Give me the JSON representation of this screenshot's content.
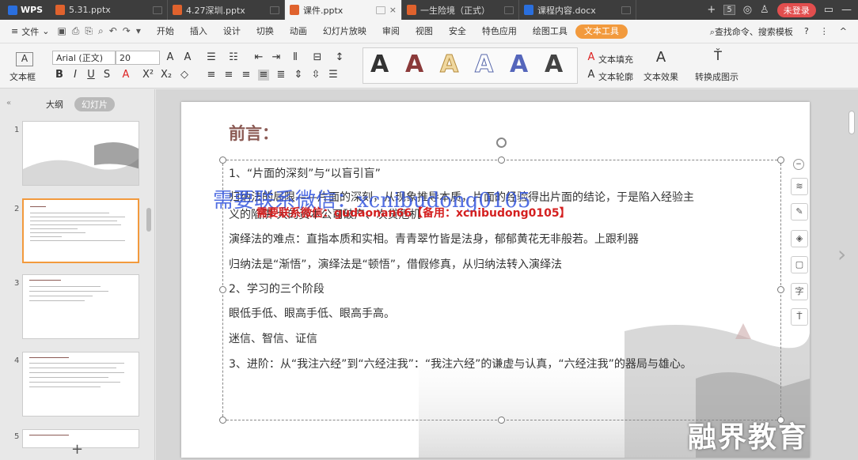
{
  "tabs": [
    {
      "label": "5.31.pptx",
      "type": "ppt"
    },
    {
      "label": "4.27深圳.pptx",
      "type": "ppt"
    },
    {
      "label": "课件.pptx",
      "type": "ppt",
      "active": true
    },
    {
      "label": "一生险境（正式）",
      "type": "ppt"
    },
    {
      "label": "课程内容.docx",
      "type": "doc"
    }
  ],
  "app": {
    "brand": "WPS",
    "add_tab": "+",
    "tab_count": "5",
    "login_label": "未登录"
  },
  "menubar": {
    "file_label": "文件",
    "items": [
      "开始",
      "插入",
      "设计",
      "切换",
      "动画",
      "幻灯片放映",
      "审阅",
      "视图",
      "安全",
      "特色应用",
      "绘图工具",
      "文本工具"
    ],
    "active_item": "文本工具",
    "search_label": "查找命令、搜索模板",
    "help": "?",
    "more": "⋮",
    "collapse": "^"
  },
  "ribbon": {
    "textbox_label": "文本框",
    "font_name": "Arial (正文)",
    "font_size": "20",
    "text_fill_label": "文本填充",
    "text_outline_label": "文本轮廓",
    "text_effect_label": "文本效果",
    "convert_label": "转换成图示"
  },
  "left_panel": {
    "tab_outline": "大纲",
    "tab_slides": "幻灯片",
    "slide_numbers": [
      "1",
      "2",
      "3",
      "4",
      "5"
    ],
    "add_slide": "+"
  },
  "slide": {
    "title": "前言：",
    "lines": [
      "1、“片面的深刻”与“以盲引盲”",
      "归纳法的局限——片面的深刻，从现象推导本质，片面的经验得出片面的结论，于是陷入经验主",
      "义的陷阱                                                   大的资本公司破产、次贷危机",
      "演绎法的难点：直指本质和实相。青青翠竹皆是法身，郁郁黄花无非般若。上跟利器",
      "归纳法是“渐悟”，演绎法是“顿悟”，借假修真，从归纳法转入演绎法",
      "2、学习的三个阶段",
      "眼低手低、眼高手低、眼高手高。",
      "迷信、智信、证信",
      "3、进阶：从“我注六经”到“六经注我”：“我注六经”的谦虚与认真，“六经注我”的器局与雄心。"
    ],
    "watermark_1": "需要联系微信：xcnibudong0105",
    "watermark_2": "需要联系微信：gudaonan66【备用：xcnibudong0105】",
    "brand": "融界教育"
  },
  "colors": {
    "accent": "#f29a3d",
    "title": "#8b5a54",
    "login": "#e24e4e"
  }
}
